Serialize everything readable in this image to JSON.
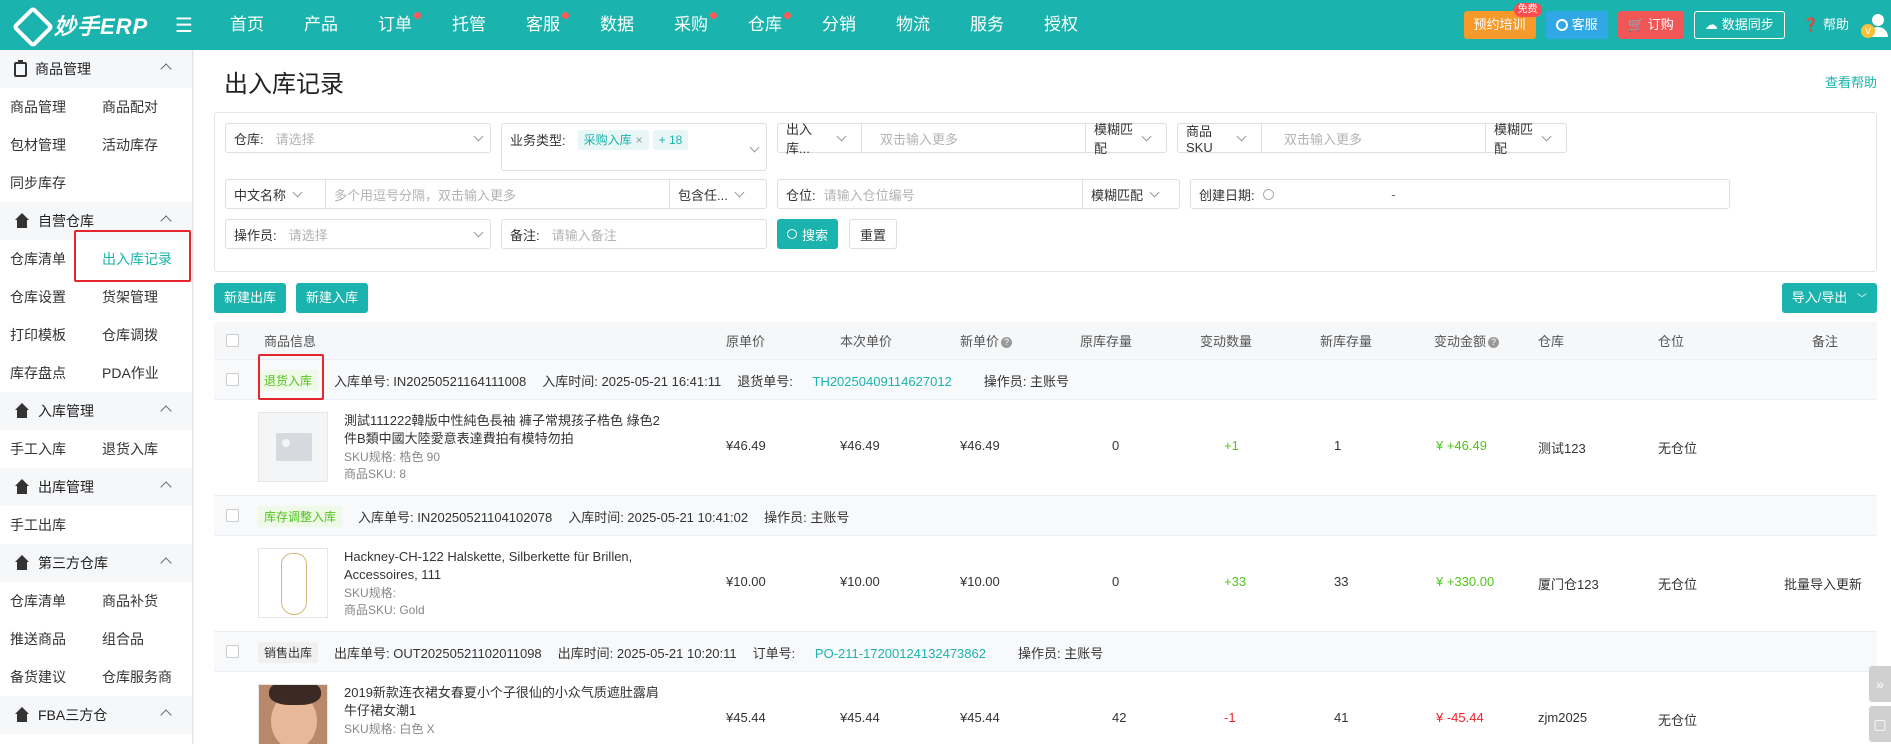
{
  "topbar": {
    "logo_text": "妙手ERP",
    "nav": [
      {
        "label": "首页",
        "dot": false
      },
      {
        "label": "产品",
        "dot": false
      },
      {
        "label": "订单",
        "dot": true
      },
      {
        "label": "托管",
        "dot": false
      },
      {
        "label": "客服",
        "dot": true
      },
      {
        "label": "数据",
        "dot": false
      },
      {
        "label": "采购",
        "dot": true
      },
      {
        "label": "仓库",
        "dot": true
      },
      {
        "label": "分销",
        "dot": false
      },
      {
        "label": "物流",
        "dot": false
      },
      {
        "label": "服务",
        "dot": false
      },
      {
        "label": "授权",
        "dot": false
      }
    ],
    "training_label": "预约培训",
    "free_badge": "免费",
    "service_label": "客服",
    "order_label": "订购",
    "sync_label": "数据同步",
    "help_label": "帮助",
    "avatar_badge": "V"
  },
  "sidebar": {
    "groups": [
      {
        "title": "商品管理",
        "icon": "clipboard-icon",
        "rows": [
          [
            "商品管理",
            "商品配对"
          ],
          [
            "包材管理",
            "活动库存"
          ],
          [
            "同步库存"
          ]
        ]
      },
      {
        "title": "自营仓库",
        "icon": "warehouse-icon",
        "rows": [
          [
            "仓库清单",
            "出入库记录"
          ],
          [
            "仓库设置",
            "货架管理"
          ],
          [
            "打印模板",
            "仓库调拨"
          ],
          [
            "库存盘点",
            "PDA作业"
          ]
        ]
      },
      {
        "title": "入库管理",
        "icon": "warehouse-icon",
        "rows": [
          [
            "手工入库",
            "退货入库"
          ]
        ]
      },
      {
        "title": "出库管理",
        "icon": "warehouse-icon",
        "rows": [
          [
            "手工出库"
          ]
        ]
      },
      {
        "title": "第三方仓库",
        "icon": "warehouse-icon",
        "rows": [
          [
            "仓库清单",
            "商品补货"
          ],
          [
            "推送商品",
            "组合品"
          ],
          [
            "备货建议",
            "仓库服务商"
          ]
        ]
      },
      {
        "title": "FBA三方仓",
        "icon": "warehouse-icon",
        "rows": []
      }
    ],
    "active_item": "出入库记录"
  },
  "page": {
    "title": "出入库记录",
    "help_link": "查看帮助"
  },
  "filters": {
    "warehouse_label": "仓库:",
    "warehouse_placeholder": "请选择",
    "biztype_label": "业务类型:",
    "biztype_tag": "采购入库",
    "biztype_more": "+ 18",
    "docno_select": "出入库...",
    "docno_placeholder": "双击输入更多",
    "fuzzy1": "模糊匹配",
    "sku_select": "商品SKU",
    "sku_placeholder": "双击输入更多",
    "fuzzy2": "模糊匹配",
    "cnname_select": "中文名称",
    "cnname_placeholder": "多个用逗号分隔，双击输入更多",
    "contains_select": "包含任...",
    "location_label": "仓位:",
    "location_placeholder": "请输入仓位编号",
    "fuzzy3": "模糊匹配",
    "created_label": "创建日期:",
    "date_sep": "-",
    "operator_label": "操作员:",
    "operator_placeholder": "请选择",
    "remark_label": "备注:",
    "remark_placeholder": "请输入备注",
    "search_label": "搜索",
    "reset_label": "重置"
  },
  "actions": {
    "new_out": "新建出库",
    "new_in": "新建入库",
    "import_export": "导入/导出"
  },
  "table": {
    "headers": {
      "product": "商品信息",
      "orig_price": "原单价",
      "this_price": "本次单价",
      "new_price": "新单价",
      "orig_stock": "原库存量",
      "change_qty": "变动数量",
      "new_stock": "新库存量",
      "change_amt": "变动金额",
      "warehouse": "仓库",
      "location": "仓位",
      "remark": "备注"
    },
    "groups": [
      {
        "type": "退货入库",
        "type_style": "green",
        "doc_label": "入库单号: IN20250521164111008",
        "time_label": "入库时间: 2025-05-21 16:41:11",
        "ref_label": "退货单号:",
        "ref_value": "TH20250409114627012",
        "operator_label": "操作员: 主账号",
        "product": {
          "image": "placeholder",
          "name_line1": "測試111222韓版中性純色長袖 褲子常規孩子梏色 綠色2",
          "name_line2": "件B類中國大陸愛意表達費拍有模特勿拍",
          "sku_spec": "SKU规格:   梏色 90",
          "sku": "商品SKU:   8",
          "orig_price": "¥46.49",
          "this_price": "¥46.49",
          "new_price": "¥46.49",
          "orig_stock": "0",
          "change_qty": "+1",
          "new_stock": "1",
          "change_amt": "¥ +46.49",
          "warehouse": "测试123",
          "location": "无仓位",
          "remark": "",
          "sign": "plus"
        }
      },
      {
        "type": "库存调整入库",
        "type_style": "green",
        "doc_label": "入库单号: IN20250521104102078",
        "time_label": "入库时间: 2025-05-21 10:41:02",
        "ref_label": "",
        "ref_value": "",
        "operator_label": "操作员: 主账号",
        "product": {
          "image": "necklace",
          "name_line1": "Hackney-CH-122 Halskette, Silberkette für Brillen,",
          "name_line2": "Accessoires, 111",
          "sku_spec": "SKU规格:",
          "sku": "商品SKU:   Gold",
          "orig_price": "¥10.00",
          "this_price": "¥10.00",
          "new_price": "¥10.00",
          "orig_stock": "0",
          "change_qty": "+33",
          "new_stock": "33",
          "change_amt": "¥ +330.00",
          "warehouse": "厦门仓123",
          "location": "无仓位",
          "remark": "批量导入更新",
          "sign": "plus"
        }
      },
      {
        "type": "销售出库",
        "type_style": "gray",
        "doc_label": "出库单号: OUT20250521102011098",
        "time_label": "出库时间: 2025-05-21 10:20:11",
        "ref_label": "订单号:",
        "ref_value": "PO-211-17200124132473862",
        "operator_label": "操作员: 主账号",
        "product": {
          "image": "person",
          "name_line1": "2019新款连衣裙女春夏小个子很仙的小众气质遮肚露肩",
          "name_line2": "牛仔裙女潮1",
          "sku_spec": "SKU规格:   白色 X",
          "sku": "",
          "orig_price": "¥45.44",
          "this_price": "¥45.44",
          "new_price": "¥45.44",
          "orig_stock": "42",
          "change_qty": "-1",
          "new_stock": "41",
          "change_amt": "¥ -45.44",
          "warehouse": "zjm2025",
          "location": "无仓位",
          "remark": "",
          "sign": "minus"
        }
      }
    ]
  },
  "colors": {
    "brand": "#1bb3ad",
    "highlight": "#e5262d",
    "positive": "#52c41a",
    "negative": "#f5222d"
  }
}
